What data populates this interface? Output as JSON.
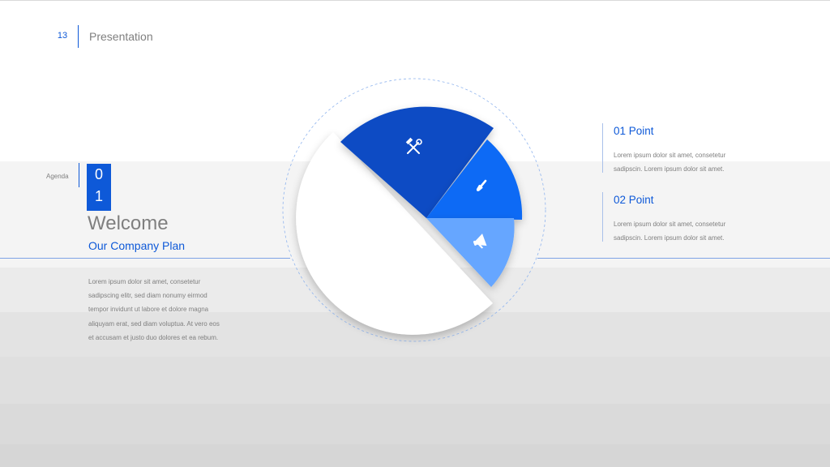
{
  "header": {
    "page_number": "13",
    "title": "Presentation"
  },
  "agenda": {
    "label": "Agenda",
    "number_digits": [
      "0",
      "1"
    ],
    "title": "Welcome",
    "subtitle": "Our Company Plan",
    "body_lines": [
      "Lorem ipsum dolor sit amet, consetetur",
      "sadipscing elitr, sed diam nonumy eirmod",
      "tempor invidunt ut labore et dolore magna",
      "aliquyam erat, sed diam voluptua. At vero eos",
      "et accusam et justo duo dolores et ea rebum."
    ]
  },
  "points": [
    {
      "title": "01 Point",
      "lines": [
        "Lorem ipsum dolor sit amet, consetetur",
        "sadipscin. Lorem ipsum dolor sit amet."
      ]
    },
    {
      "title": "02 Point",
      "lines": [
        "Lorem ipsum dolor sit amet, consetetur",
        "sadipscin. Lorem ipsum dolor sit amet."
      ]
    }
  ],
  "wheel": {
    "segments": [
      {
        "icon": "tools-icon",
        "color": "#0b4cc4"
      },
      {
        "icon": "brush-icon",
        "color": "#0b6af5"
      },
      {
        "icon": "megaphone-icon",
        "color": "#66a6ff"
      }
    ]
  },
  "colors": {
    "accent": "#0e59d8",
    "text_gray": "#7f7f7f",
    "band_colors": [
      "#f4f4f4",
      "#ebebeb",
      "#e3e3e3",
      "#dfdfdf",
      "#dadada",
      "#d6d6d6"
    ]
  }
}
